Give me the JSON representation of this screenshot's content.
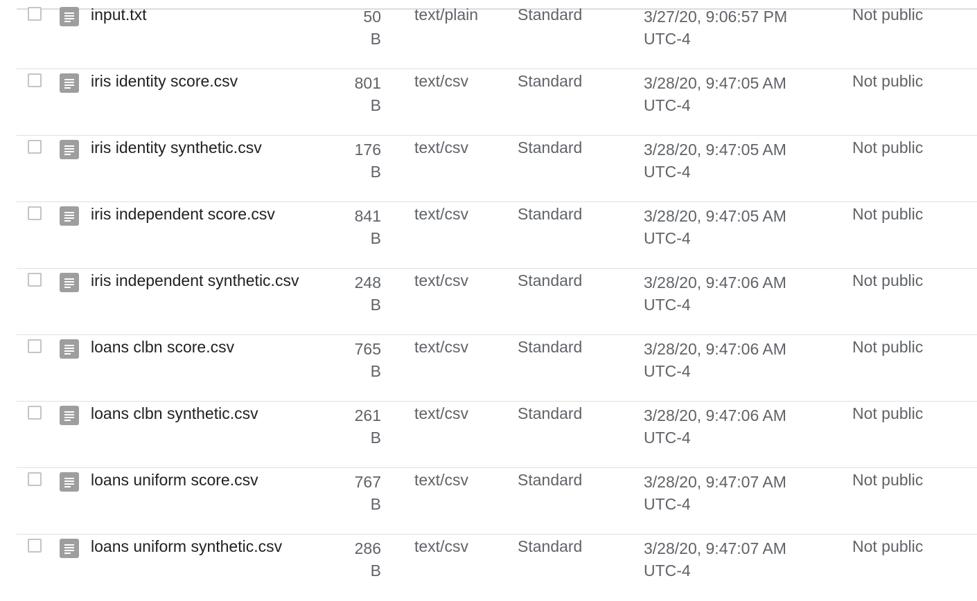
{
  "rows": [
    {
      "name": "input.txt",
      "size": "50 B",
      "type": "text/plain",
      "storage": "Standard",
      "created_date": "3/27/20, 9:06:57 PM",
      "created_tz": "UTC-4",
      "access": "Not public"
    },
    {
      "name": "iris identity score.csv",
      "size": "801 B",
      "type": "text/csv",
      "storage": "Standard",
      "created_date": "3/28/20, 9:47:05 AM",
      "created_tz": "UTC-4",
      "access": "Not public"
    },
    {
      "name": "iris identity synthetic.csv",
      "size": "176 B",
      "type": "text/csv",
      "storage": "Standard",
      "created_date": "3/28/20, 9:47:05 AM",
      "created_tz": "UTC-4",
      "access": "Not public"
    },
    {
      "name": "iris independent score.csv",
      "size": "841 B",
      "type": "text/csv",
      "storage": "Standard",
      "created_date": "3/28/20, 9:47:05 AM",
      "created_tz": "UTC-4",
      "access": "Not public"
    },
    {
      "name": "iris independent synthetic.csv",
      "size": "248 B",
      "type": "text/csv",
      "storage": "Standard",
      "created_date": "3/28/20, 9:47:06 AM",
      "created_tz": "UTC-4",
      "access": "Not public"
    },
    {
      "name": "loans clbn score.csv",
      "size": "765 B",
      "type": "text/csv",
      "storage": "Standard",
      "created_date": "3/28/20, 9:47:06 AM",
      "created_tz": "UTC-4",
      "access": "Not public"
    },
    {
      "name": "loans clbn synthetic.csv",
      "size": "261 B",
      "type": "text/csv",
      "storage": "Standard",
      "created_date": "3/28/20, 9:47:06 AM",
      "created_tz": "UTC-4",
      "access": "Not public"
    },
    {
      "name": "loans uniform score.csv",
      "size": "767 B",
      "type": "text/csv",
      "storage": "Standard",
      "created_date": "3/28/20, 9:47:07 AM",
      "created_tz": "UTC-4",
      "access": "Not public"
    },
    {
      "name": "loans uniform synthetic.csv",
      "size": "286 B",
      "type": "text/csv",
      "storage": "Standard",
      "created_date": "3/28/20, 9:47:07 AM",
      "created_tz": "UTC-4",
      "access": "Not public"
    }
  ],
  "icons": {
    "file": "file-text-icon",
    "checkbox": "checkbox-unchecked"
  },
  "colors": {
    "icon_bg": "#9e9e9e",
    "divider": "#e0e0e0",
    "muted_text": "#5f6368"
  }
}
